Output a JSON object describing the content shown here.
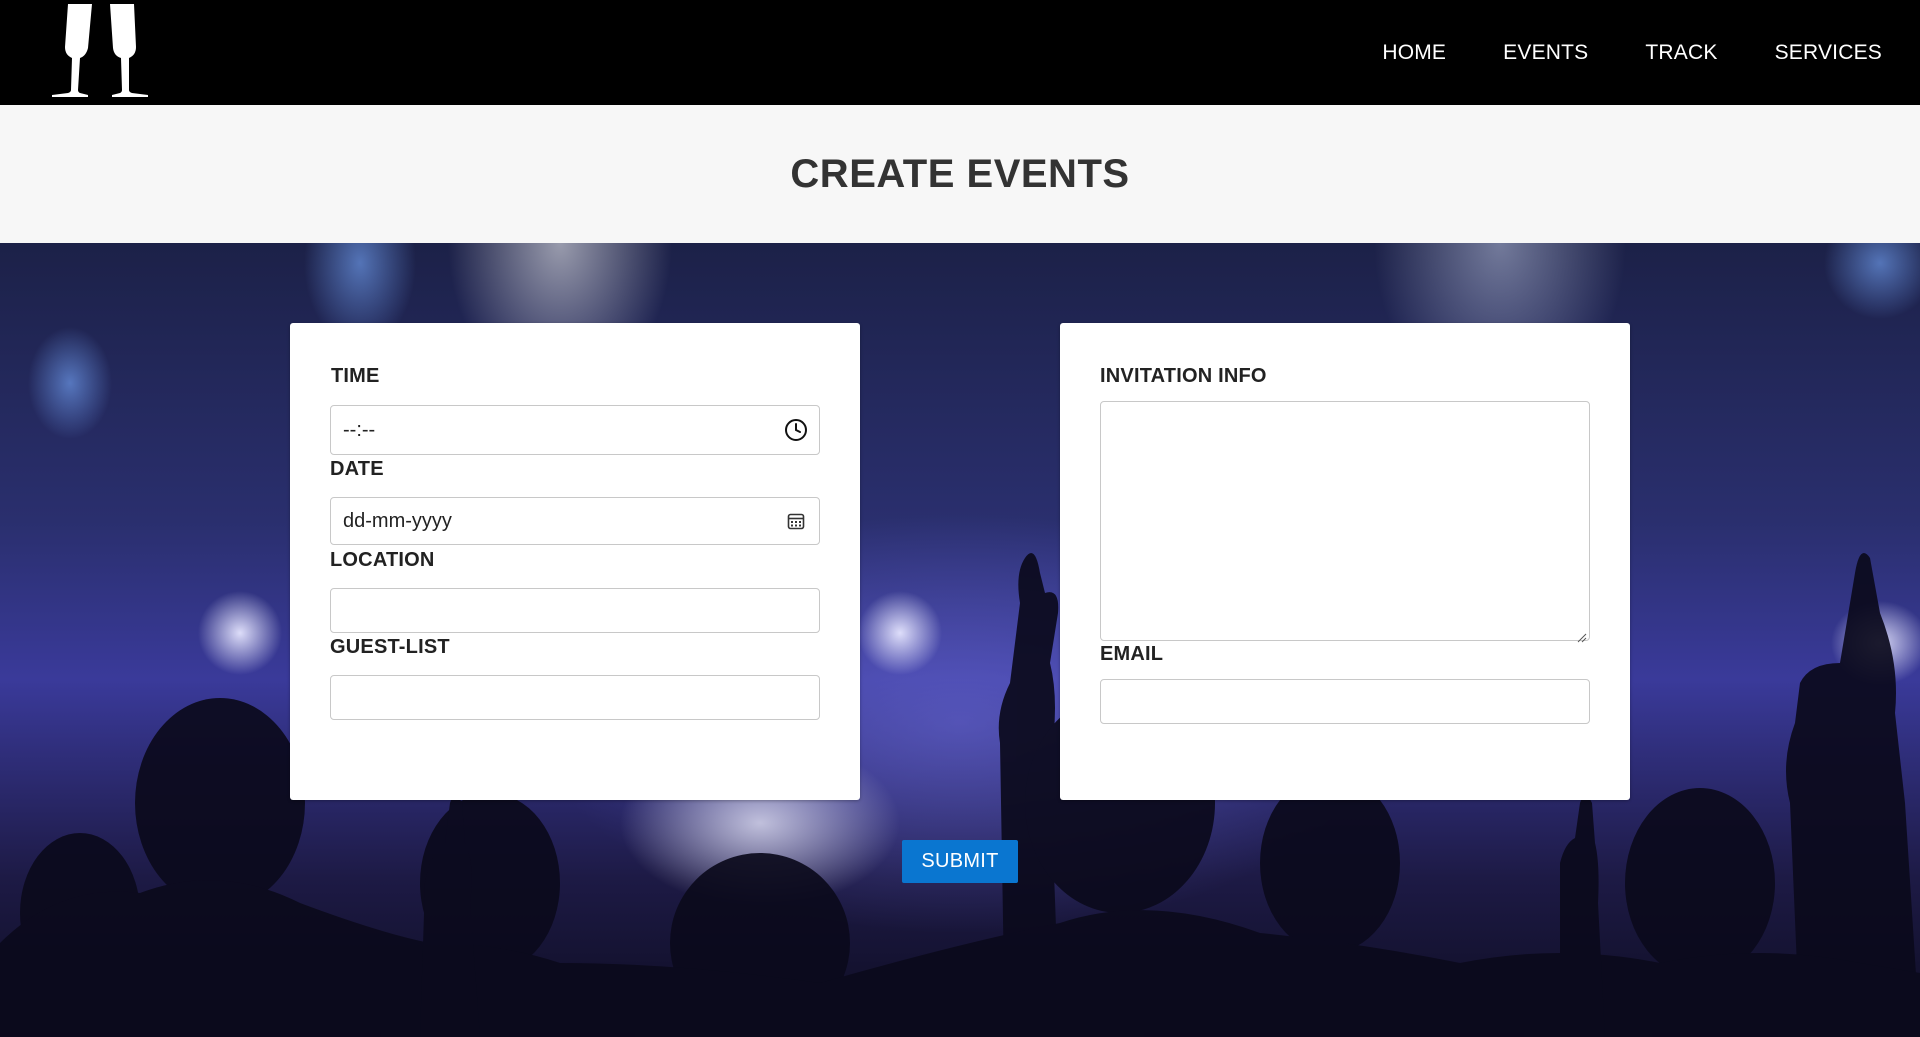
{
  "nav": {
    "items": [
      {
        "label": "HOME"
      },
      {
        "label": "EVENTS"
      },
      {
        "label": "TRACK"
      },
      {
        "label": "SERVICES"
      }
    ]
  },
  "page": {
    "title": "CREATE EVENTS"
  },
  "form_left": {
    "time_label": "TIME",
    "time_value": "--:--",
    "date_label": "DATE",
    "date_value": "dd-mm-yyyy",
    "location_label": "LOCATION",
    "location_value": "",
    "guestlist_label": "GUEST-LIST",
    "guestlist_value": ""
  },
  "form_right": {
    "invitation_label": "INVITATION INFO",
    "invitation_value": "",
    "email_label": "EMAIL",
    "email_value": ""
  },
  "actions": {
    "submit_label": "SUBMIT"
  },
  "colors": {
    "navbar": "#000000",
    "title_band": "#f7f7f7",
    "submit_button": "#0a76d0"
  },
  "icons": {
    "logo": "champagne-glasses-icon",
    "time": "clock-icon",
    "date": "calendar-icon"
  }
}
